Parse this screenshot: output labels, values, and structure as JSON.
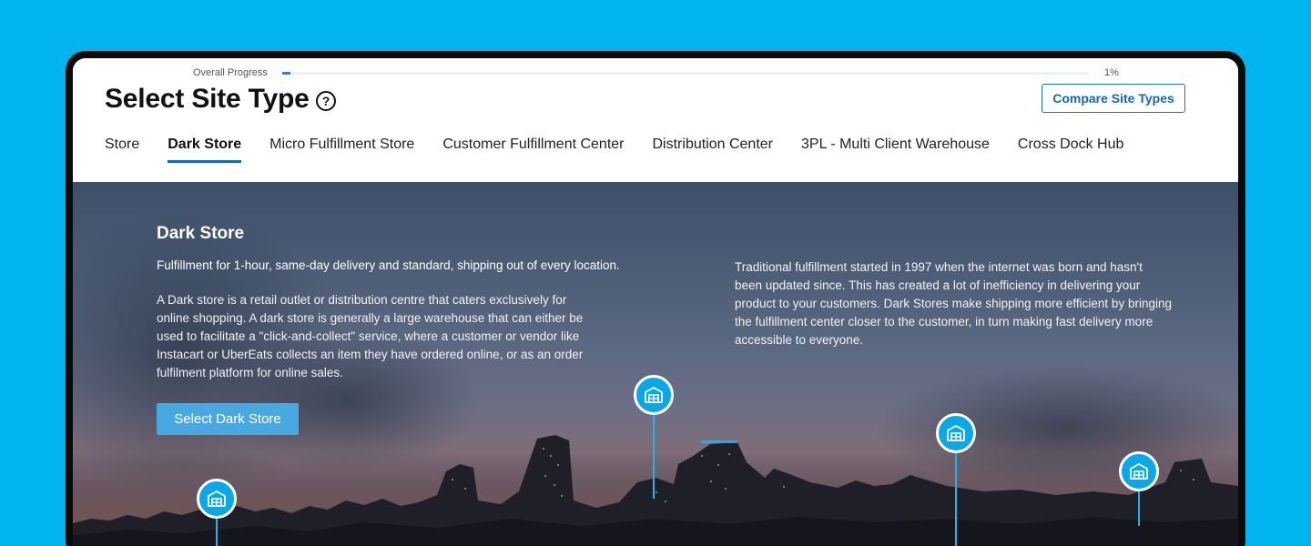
{
  "progress": {
    "label": "Overall Progress",
    "percent_text": "1%",
    "value": 0.01
  },
  "header": {
    "title": "Select Site Type",
    "help_icon": "question-circle-icon",
    "compare_button": "Compare Site Types"
  },
  "tabs": [
    {
      "label": "Store",
      "active": false
    },
    {
      "label": "Dark Store",
      "active": true
    },
    {
      "label": "Micro Fulfillment Store",
      "active": false
    },
    {
      "label": "Customer Fulfillment Center",
      "active": false
    },
    {
      "label": "Distribution Center",
      "active": false
    },
    {
      "label": "3PL - Multi Client Warehouse",
      "active": false
    },
    {
      "label": "Cross Dock Hub",
      "active": false
    }
  ],
  "hero": {
    "title": "Dark Store",
    "subtitle": "Fulfillment for 1-hour, same-day delivery and standard, shipping out of every location.",
    "description": "A Dark store is a retail outlet or distribution centre that caters exclusively for online shopping. A dark store is generally a large warehouse that can either be used to facilitate a \"click-and-collect\" service, where a customer or vendor like Instacart or UberEats collects an item they have ordered online, or as an order fulfilment platform for online sales.",
    "side_text": "Traditional fulfillment started in 1997 when the internet was born and hasn't been updated since. This has created a lot of inefficiency in delivering your product to your customers. Dark Stores make shipping more efficient by bringing the fulfillment center closer to the customer, in turn making fast delivery more accessible to everyone.",
    "select_button": "Select Dark Store",
    "pin_icon": "warehouse-icon"
  },
  "colors": {
    "background": "#00b5ee",
    "accent": "#1667b6",
    "pin": "#0ba7e6",
    "select_button": "#4aa8e0"
  }
}
